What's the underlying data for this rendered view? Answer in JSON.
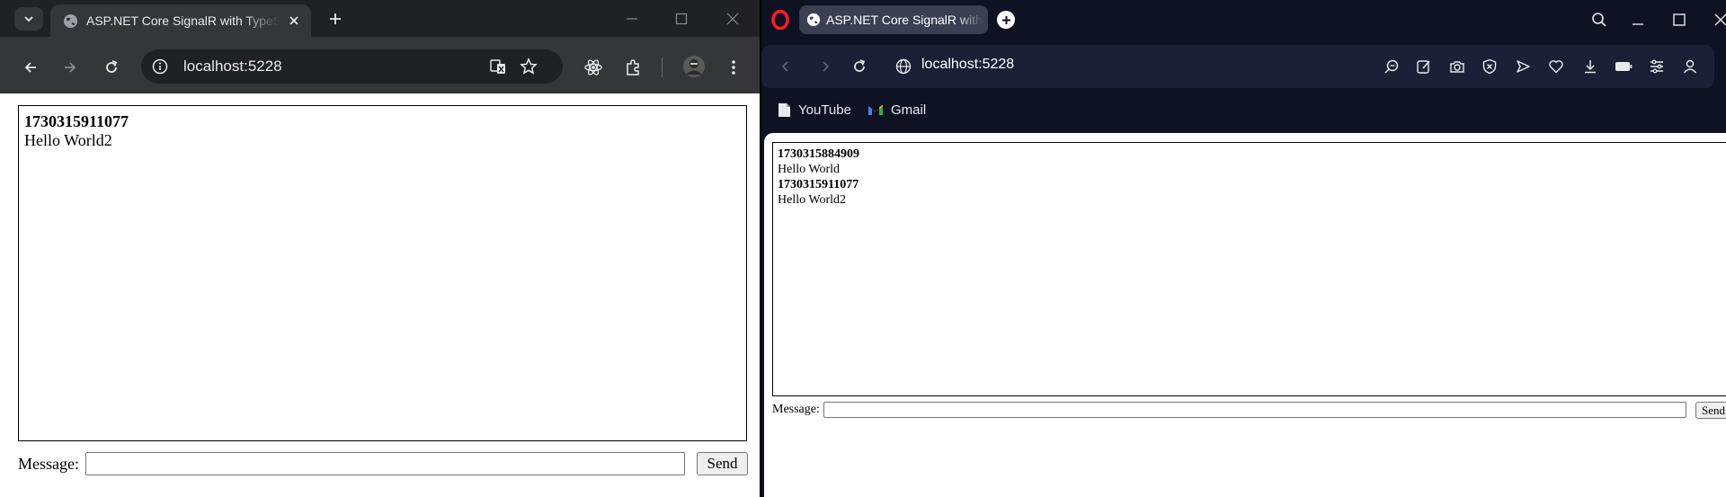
{
  "chrome": {
    "tab_title": "ASP.NET Core SignalR with TypeScript",
    "url": "localhost:5228",
    "messages": [
      {
        "id": "1730315911077",
        "text": "Hello World2"
      }
    ],
    "message_label": "Message:",
    "message_value": "",
    "send_label": "Send"
  },
  "opera": {
    "tab_title": "ASP.NET Core SignalR with TypeScript",
    "url": "localhost:5228",
    "bookmarks": [
      {
        "label": "YouTube",
        "icon": "bookmark-folder-icon"
      },
      {
        "label": "Gmail",
        "icon": "gmail-icon"
      }
    ],
    "messages": [
      {
        "id": "1730315884909",
        "text": "Hello World"
      },
      {
        "id": "1730315911077",
        "text": "Hello World2"
      }
    ],
    "message_label": "Message:",
    "message_value": "",
    "send_label": "Send"
  },
  "colors": {
    "chrome_tabstrip": "#202124",
    "chrome_toolbar": "#35363a",
    "opera_background": "#0e1222",
    "opera_navbar": "#1b2036",
    "opera_logo": "#ff1b2d"
  }
}
